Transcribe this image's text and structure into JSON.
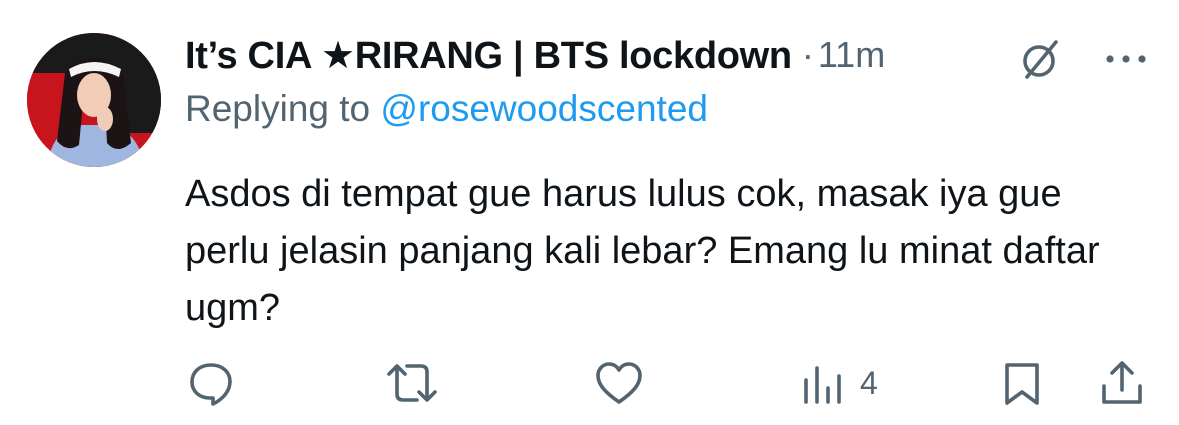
{
  "tweet": {
    "display_name": "It’s CIA ★RIRANG | BTS lockdown",
    "separator": "·",
    "time": "11m",
    "replying_prefix": "Replying to ",
    "replying_handle": "@rosewoodscented",
    "text": "Asdos di tempat gue harus lulus cok, masak iya gue perlu jelasin panjang kali lebar? Emang lu minat daftar ugm?"
  },
  "actions": {
    "views_count": "4"
  },
  "icons": {
    "header": [
      "grok-icon",
      "more-icon"
    ],
    "actions": [
      "reply-icon",
      "retweet-icon",
      "like-icon",
      "views-icon",
      "bookmark-icon",
      "share-icon"
    ]
  },
  "colors": {
    "text": "#0f1419",
    "secondary": "#536471",
    "link": "#1d9bf0",
    "avatar_bg": "#c8141c"
  }
}
